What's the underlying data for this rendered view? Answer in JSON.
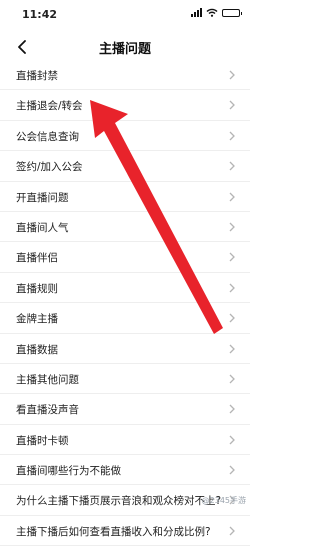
{
  "status": {
    "time": "11:42"
  },
  "header": {
    "title": "主播问题"
  },
  "items": [
    {
      "label": "直播封禁"
    },
    {
      "label": "主播退会/转会"
    },
    {
      "label": "公会信息查询"
    },
    {
      "label": "签约/加入公会"
    },
    {
      "label": "开直播问题"
    },
    {
      "label": "直播间人气"
    },
    {
      "label": "直播伴侣"
    },
    {
      "label": "直播规则"
    },
    {
      "label": "金牌主播"
    },
    {
      "label": "直播数据"
    },
    {
      "label": "主播其他问题"
    },
    {
      "label": "看直播没声音"
    },
    {
      "label": "直播时卡顿"
    },
    {
      "label": "直播间哪些行为不能做"
    },
    {
      "label": "为什么主播下播页展示音浪和观众榜对不上?"
    },
    {
      "label": "主播下播后如何查看直播收入和分成比例?"
    }
  ],
  "annotation": {
    "arrow_color": "#e8232b"
  },
  "watermark": {
    "text": "@2345手游"
  }
}
